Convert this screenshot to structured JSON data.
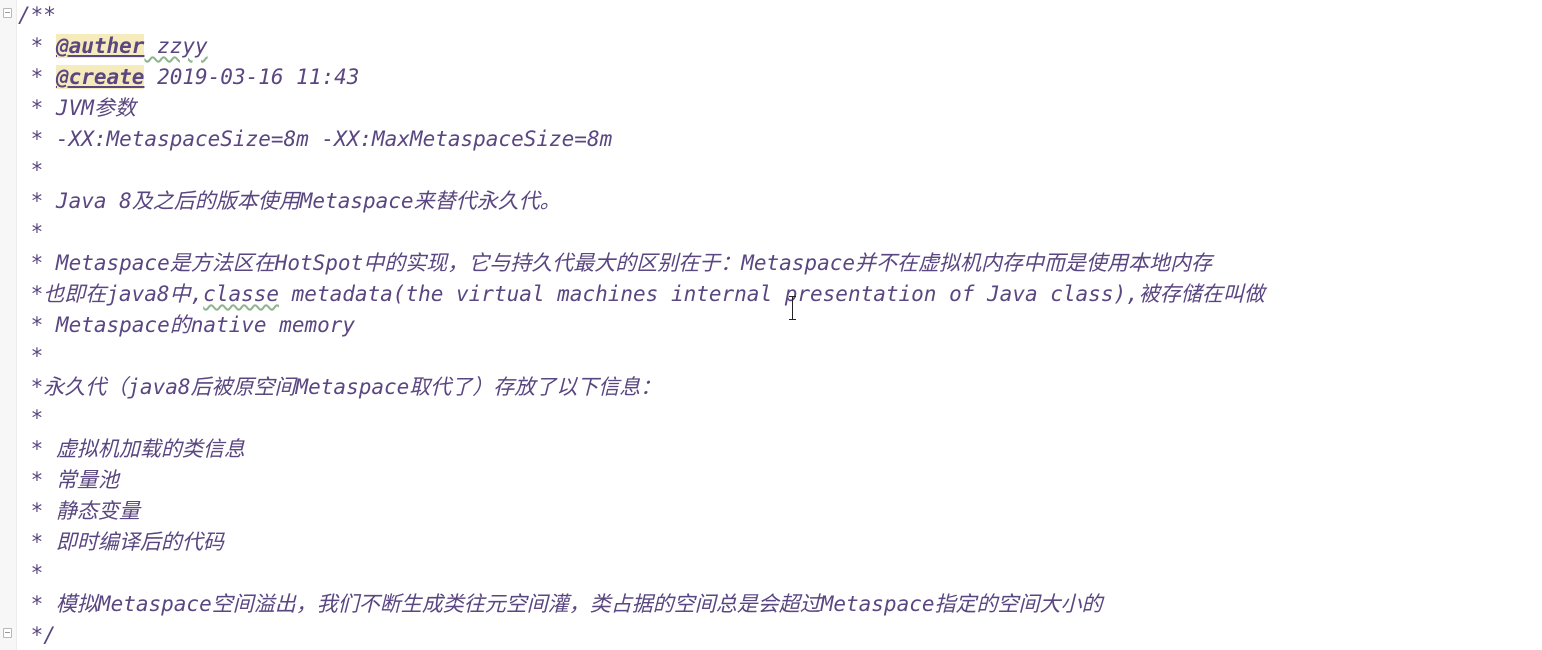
{
  "editor": {
    "comment_lines": [
      "/**",
      " * ",
      " * ",
      " * JVM参数",
      " * -XX:MetaspaceSize=8m -XX:MaxMetaspaceSize=8m",
      " *",
      " * Java 8及之后的版本使用Metaspace来替代永久代。",
      " *",
      " * Metaspace是方法区在HotSpot中的实现，它与持久代最大的区别在于：Metaspace并不在虚拟机内存中而是使用本地内存",
      " *也即在java8中,",
      " * Metaspace的native memory",
      " *",
      " *永久代（java8后被原空间Metaspace取代了）存放了以下信息：",
      " *",
      " * 虚拟机加载的类信息",
      " * 常量池",
      " * 静态变量",
      " * 即时编译后的代码",
      " *",
      " * 模拟Metaspace空间溢出，我们不断生成类往元空间灌，类占据的空间总是会超过Metaspace指定的空间大小的",
      " */"
    ],
    "auther_tag": "@auther",
    "auther_value": " zzyy",
    "create_tag": "@create",
    "create_value": " 2019-03-16 11:43",
    "line9_word": "classe",
    "line9_rest": " metadata(the virtual machines internal presentation of Java class),被存储在叫做"
  },
  "colors": {
    "comment_text": "#5a4680",
    "tag_highlight": "#f6ebbd",
    "typo_underline": "#8fb58f",
    "background": "#ffffff"
  }
}
